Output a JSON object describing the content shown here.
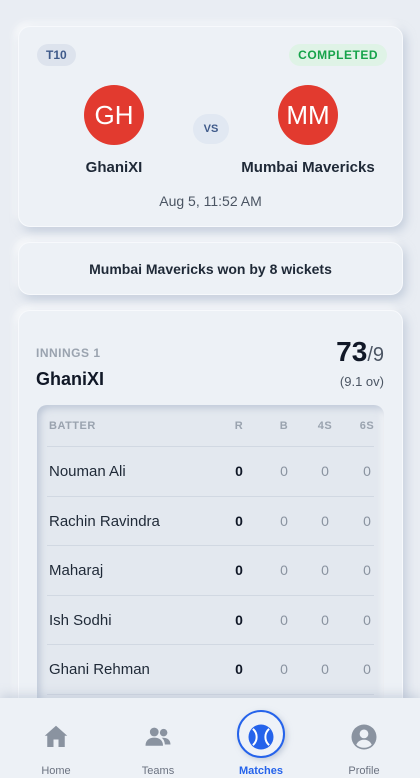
{
  "match": {
    "format": "T10",
    "status": "COMPLETED",
    "team_a": {
      "initials": "GH",
      "name": "GhaniXI"
    },
    "team_b": {
      "initials": "MM",
      "name": "Mumbai Mavericks"
    },
    "vs_label": "VS",
    "datetime": "Aug 5, 11:52 AM"
  },
  "result": "Mumbai Mavericks won by 8 wickets",
  "innings": {
    "label": "INNINGS 1",
    "team": "GhaniXI",
    "runs": "73",
    "wickets": "/9",
    "overs": "(9.1 ov)",
    "headers": {
      "batter": "BATTER",
      "r": "R",
      "b": "B",
      "fours": "4S",
      "sixes": "6S"
    },
    "batters": [
      {
        "name": "Nouman Ali",
        "r": "0",
        "b": "0",
        "fours": "0",
        "sixes": "0"
      },
      {
        "name": "Rachin Ravindra",
        "r": "0",
        "b": "0",
        "fours": "0",
        "sixes": "0"
      },
      {
        "name": "Maharaj",
        "r": "0",
        "b": "0",
        "fours": "0",
        "sixes": "0"
      },
      {
        "name": "Ish Sodhi",
        "r": "0",
        "b": "0",
        "fours": "0",
        "sixes": "0"
      },
      {
        "name": "Ghani Rehman",
        "r": "0",
        "b": "0",
        "fours": "0",
        "sixes": "0"
      }
    ]
  },
  "nav": {
    "items": [
      {
        "label": "Home",
        "icon": "home-icon"
      },
      {
        "label": "Teams",
        "icon": "users-icon"
      },
      {
        "label": "Matches",
        "icon": "ball-icon",
        "active": true
      },
      {
        "label": "Profile",
        "icon": "user-icon"
      }
    ]
  },
  "colors": {
    "accent": "#2563eb",
    "team_avatar": "#e23a2f",
    "status_green": "#16a34a",
    "background": "#e9edf3"
  }
}
